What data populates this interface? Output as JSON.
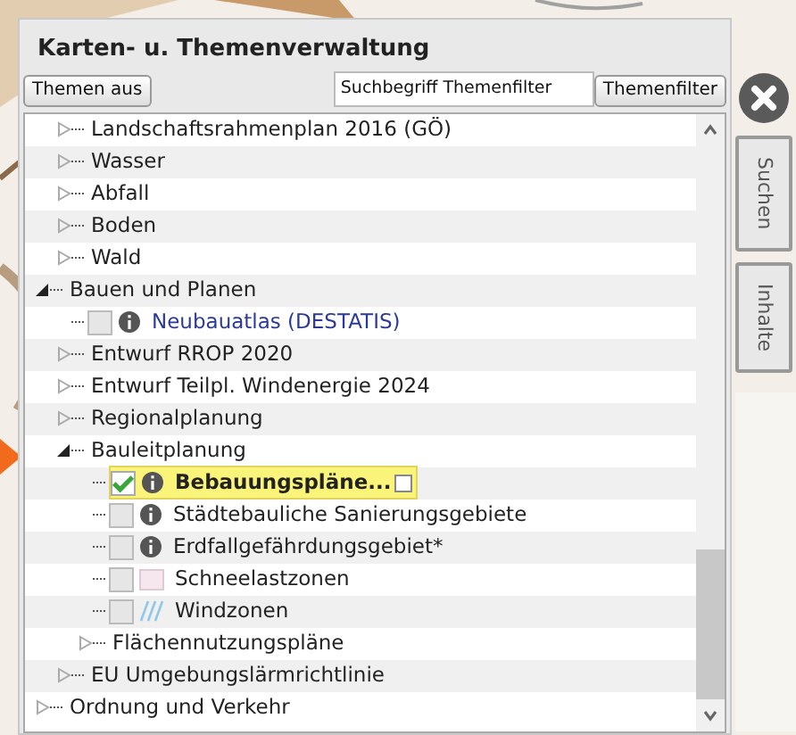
{
  "title": "Karten- u. Themenverwaltung",
  "buttons": {
    "themes_off": "Themen aus",
    "filter": "Themenfilter"
  },
  "search": {
    "placeholder": "Suchbegriff Themenfilter"
  },
  "tree": {
    "continued_children": [
      {
        "kind": "folder",
        "label": "Landschaftsrahmenplan 2016 (GÖ)",
        "expanded": false
      },
      {
        "kind": "folder",
        "label": "Wasser",
        "expanded": false
      },
      {
        "kind": "folder",
        "label": "Abfall",
        "expanded": false
      },
      {
        "kind": "folder",
        "label": "Boden",
        "expanded": false
      },
      {
        "kind": "folder",
        "label": "Wald",
        "expanded": false
      }
    ],
    "items": [
      {
        "kind": "folder",
        "label": "Bauen und Planen",
        "expanded": true,
        "children": [
          {
            "kind": "layer",
            "label": "Neubauatlas (DESTATIS)",
            "checked": false,
            "selected": false,
            "legend": {
              "kind": "info"
            },
            "link": true
          },
          {
            "kind": "folder",
            "label": "Entwurf RROP 2020",
            "expanded": false
          },
          {
            "kind": "folder",
            "label": "Entwurf Teilpl. Windenergie 2024",
            "expanded": false
          },
          {
            "kind": "folder",
            "label": "Regionalplanung",
            "expanded": false
          },
          {
            "kind": "folder",
            "label": "Bauleitplanung",
            "expanded": true,
            "children": [
              {
                "kind": "layer",
                "label": "Bebauungspläne...",
                "checked": true,
                "selected": true,
                "legend": {
                  "kind": "info"
                },
                "link": false
              },
              {
                "kind": "layer",
                "label": "Städtebauliche Sanierungsgebiete",
                "checked": false,
                "selected": false,
                "legend": {
                  "kind": "info"
                },
                "link": false
              },
              {
                "kind": "layer",
                "label": "Erdfallgefährdungsgebiet*",
                "checked": false,
                "selected": false,
                "legend": {
                  "kind": "info"
                },
                "link": false
              },
              {
                "kind": "layer",
                "label": "Schneelastzonen",
                "checked": false,
                "selected": false,
                "legend": {
                  "kind": "swatch"
                },
                "link": false
              },
              {
                "kind": "layer",
                "label": "Windzonen",
                "checked": false,
                "selected": false,
                "legend": {
                  "kind": "hatch"
                },
                "link": false
              },
              {
                "kind": "folder",
                "label": "Flächennutzungspläne",
                "expanded": false
              }
            ]
          },
          {
            "kind": "folder",
            "label": "EU Umgebungslärmrichtlinie",
            "expanded": false
          }
        ]
      },
      {
        "kind": "folder",
        "label": "Ordnung und Verkehr",
        "expanded": false
      }
    ]
  },
  "side_tabs": [
    {
      "label": "Suchen"
    },
    {
      "label": "Inhalte"
    }
  ]
}
